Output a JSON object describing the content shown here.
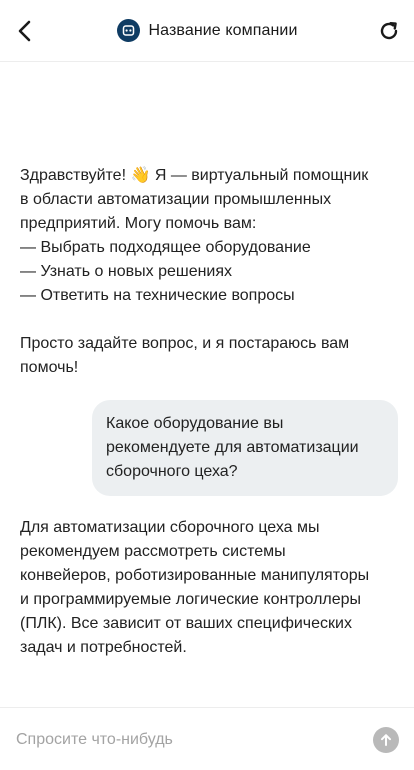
{
  "header": {
    "title": "Название компании",
    "back_icon": "chevron-left-icon",
    "refresh_icon": "refresh-icon",
    "logo_icon": "company-logo-icon",
    "logo_color": "#0f3c63"
  },
  "messages": {
    "bot_greeting": {
      "lines": [
        "Здравствуйте! 👋 Я — виртуальный помощник",
        "в области автоматизации промышленных",
        "предприятий. Могу помочь вам:",
        "— Выбрать подходящее оборудование",
        "— Узнать о новых решениях",
        "— Ответить на технические вопросы"
      ],
      "closing_lines": [
        "Просто задайте вопрос, и я постараюсь вам",
        "помочь!"
      ]
    },
    "user_question": {
      "lines": [
        "Какое оборудование вы",
        "рекомендуете для автоматизации",
        "сборочного цеха?"
      ],
      "bubble_color": "#eceff1"
    },
    "bot_answer": {
      "lines": [
        "Для автоматизации сборочного цеха мы",
        "рекомендуем рассмотреть системы",
        "конвейеров, роботизированные манипуляторы",
        "и программируемые логические контроллеры",
        "(ПЛК). Все зависит от ваших специфических",
        "задач и потребностей."
      ]
    }
  },
  "composer": {
    "placeholder": "Спросите что-нибудь",
    "value": "",
    "send_icon": "arrow-up-icon",
    "send_color": "#b9b9b9"
  }
}
